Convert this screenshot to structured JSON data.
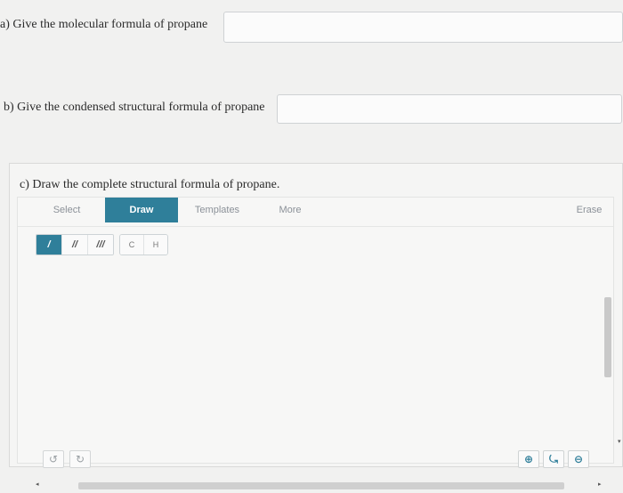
{
  "question_a": {
    "label": "a) Give the molecular formula of propane",
    "value": ""
  },
  "question_b": {
    "label": "b) Give the condensed structural formula of propane",
    "value": ""
  },
  "question_c": {
    "label": "c) Draw the complete structural formula of propane."
  },
  "editor": {
    "tabs": {
      "select": "Select",
      "draw": "Draw",
      "templates": "Templates",
      "more": "More",
      "erase": "Erase"
    },
    "active_tab": "Draw",
    "bonds": {
      "single": "/",
      "double": "//",
      "triple": "///"
    },
    "atoms": {
      "carbon": "C",
      "hydrogen": "H"
    },
    "icons": {
      "undo": "undo-icon",
      "redo": "redo-icon",
      "zoom_in": "zoom-in-icon",
      "zoom_reset": "zoom-reset-icon",
      "zoom_out": "zoom-out-icon"
    },
    "glyphs": {
      "undo": "↺",
      "redo": "↻",
      "zoom_in": "⊕",
      "zoom_reset": "⤿",
      "zoom_out": "⊖",
      "left": "◂",
      "right": "▸",
      "down": "▾"
    }
  },
  "colors": {
    "accent": "#2f7f9a"
  }
}
